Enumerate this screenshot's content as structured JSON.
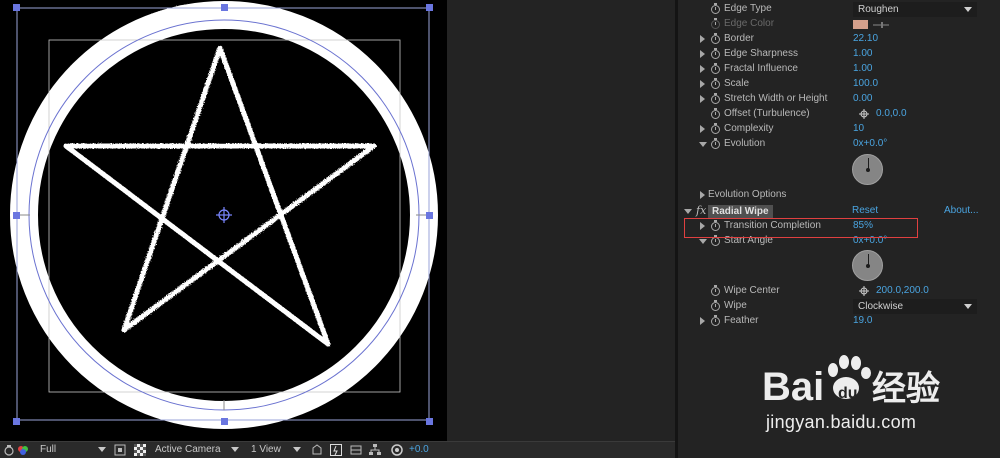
{
  "viewer_toolbar": {
    "resolution": "Full",
    "camera": "Active Camera",
    "views": "1 View",
    "exposure": "+0.0"
  },
  "effect_controls": {
    "rows": [
      {
        "name": "Edge Type",
        "value": "Roughen",
        "kind": "dropdown"
      },
      {
        "name": "Edge Color",
        "value": "",
        "kind": "color",
        "disabled": true
      },
      {
        "name": "Border",
        "value": "22.10"
      },
      {
        "name": "Edge Sharpness",
        "value": "1.00"
      },
      {
        "name": "Fractal Influence",
        "value": "1.00"
      },
      {
        "name": "Scale",
        "value": "100.0"
      },
      {
        "name": "Stretch Width or Height",
        "value": "0.00"
      },
      {
        "name": "Offset (Turbulence)",
        "value": "0.0,0.0",
        "kind": "point"
      },
      {
        "name": "Complexity",
        "value": "10"
      },
      {
        "name": "Evolution",
        "value": "0x+0.0°",
        "kind": "angle"
      }
    ],
    "evolution_options": "Evolution Options",
    "radial_wipe": {
      "fx_badge": "fx",
      "name": "Radial Wipe",
      "reset": "Reset",
      "about": "About...",
      "transition_completion_label": "Transition Completion",
      "transition_completion": "85%",
      "start_angle_label": "Start Angle",
      "start_angle": "0x+0.0°",
      "wipe_center_label": "Wipe Center",
      "wipe_center": "200.0,200.0",
      "wipe_label": "Wipe",
      "wipe": "Clockwise",
      "feather_label": "Feather",
      "feather": "19.0"
    }
  },
  "watermark": {
    "logo": "Bai du 经验",
    "url": "jingyan.baidu.com"
  },
  "colors": {
    "accent_value": "#4aa4e0",
    "highlight_box": "#e04040",
    "edge_color_swatch": "#d4a08c"
  }
}
